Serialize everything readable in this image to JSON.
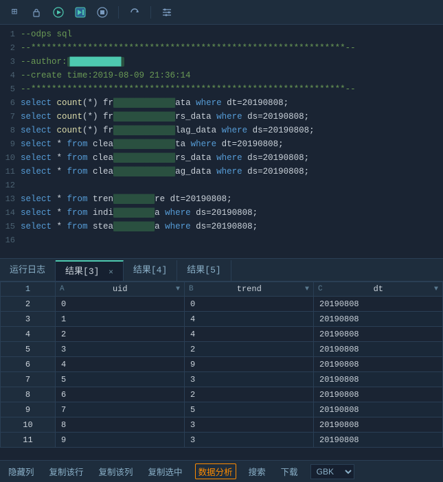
{
  "toolbar": {
    "icons": [
      {
        "name": "grid-icon",
        "symbol": "⊞",
        "active": false
      },
      {
        "name": "lock-icon",
        "symbol": "🔒",
        "active": false
      },
      {
        "name": "play-icon",
        "symbol": "▶",
        "active": true
      },
      {
        "name": "step-icon",
        "symbol": "▶|",
        "active": true
      },
      {
        "name": "stop-icon",
        "symbol": "⏹",
        "active": false
      },
      {
        "name": "refresh-icon",
        "symbol": "↻",
        "active": false
      },
      {
        "name": "tools-icon",
        "symbol": "✕",
        "active": false
      }
    ]
  },
  "editor": {
    "lines": [
      {
        "num": 1,
        "text": "--odps sql",
        "type": "comment"
      },
      {
        "num": 2,
        "text": "--*************************************************************--",
        "type": "comment"
      },
      {
        "num": 3,
        "text": "--author:",
        "type": "comment"
      },
      {
        "num": 4,
        "text": "--create time:2019-08-09 21:36:14",
        "type": "comment"
      },
      {
        "num": 5,
        "text": "--*************************************************************--",
        "type": "comment"
      },
      {
        "num": 6,
        "text": "select count(*) fr████████████ata where dt=20190808;",
        "type": "sql"
      },
      {
        "num": 7,
        "text": "select count(*) fr████████████rs_data where ds=20190808;",
        "type": "sql"
      },
      {
        "num": 8,
        "text": "select count(*) fr████████████lag_data where ds=20190808;",
        "type": "sql"
      },
      {
        "num": 9,
        "text": "SELECT * from clea████████████ta where dt=20190808;",
        "type": "sql"
      },
      {
        "num": 10,
        "text": "SELECT * from clea████████████rs_data where ds=20190808;",
        "type": "sql"
      },
      {
        "num": 11,
        "text": "SELECT * from clea████████████ag_data where ds=20190808;",
        "type": "sql"
      },
      {
        "num": 12,
        "text": "",
        "type": "blank"
      },
      {
        "num": 13,
        "text": "select * from tren████████re dt=20190808;",
        "type": "sql"
      },
      {
        "num": 14,
        "text": "select * from indi████████a where ds=20190808;",
        "type": "sql"
      },
      {
        "num": 15,
        "text": "select * from stea████████a where ds=20190808;",
        "type": "sql"
      },
      {
        "num": 16,
        "text": "",
        "type": "blank"
      }
    ]
  },
  "tabs": {
    "items": [
      {
        "label": "运行日志",
        "active": false,
        "closable": false
      },
      {
        "label": "结果[3]",
        "active": true,
        "closable": true
      },
      {
        "label": "结果[4]",
        "active": false,
        "closable": false
      },
      {
        "label": "结果[5]",
        "active": false,
        "closable": false
      }
    ]
  },
  "table": {
    "columns": [
      {
        "letter": "A",
        "name": "uid"
      },
      {
        "letter": "B",
        "name": "trend"
      },
      {
        "letter": "C",
        "name": "dt"
      }
    ],
    "rows": [
      {
        "rowNum": "2",
        "uid": "0",
        "trend": "0",
        "dt": "20190808"
      },
      {
        "rowNum": "3",
        "uid": "1",
        "trend": "4",
        "dt": "20190808"
      },
      {
        "rowNum": "4",
        "uid": "2",
        "trend": "4",
        "dt": "20190808"
      },
      {
        "rowNum": "5",
        "uid": "3",
        "trend": "2",
        "dt": "20190808"
      },
      {
        "rowNum": "6",
        "uid": "4",
        "trend": "9",
        "dt": "20190808"
      },
      {
        "rowNum": "7",
        "uid": "5",
        "trend": "3",
        "dt": "20190808"
      },
      {
        "rowNum": "8",
        "uid": "6",
        "trend": "2",
        "dt": "20190808"
      },
      {
        "rowNum": "9",
        "uid": "7",
        "trend": "5",
        "dt": "20190808"
      },
      {
        "rowNum": "10",
        "uid": "8",
        "trend": "3",
        "dt": "20190808"
      },
      {
        "rowNum": "11",
        "uid": "9",
        "trend": "3",
        "dt": "20190808"
      }
    ]
  },
  "bottomBar": {
    "hideCol": "隐藏列",
    "copyRow": "复制该行",
    "copyCol": "复制该列",
    "copySelect": "复制选中",
    "analyze": "数据分析",
    "search": "搜索",
    "download": "下载",
    "encoding": "GBK"
  }
}
